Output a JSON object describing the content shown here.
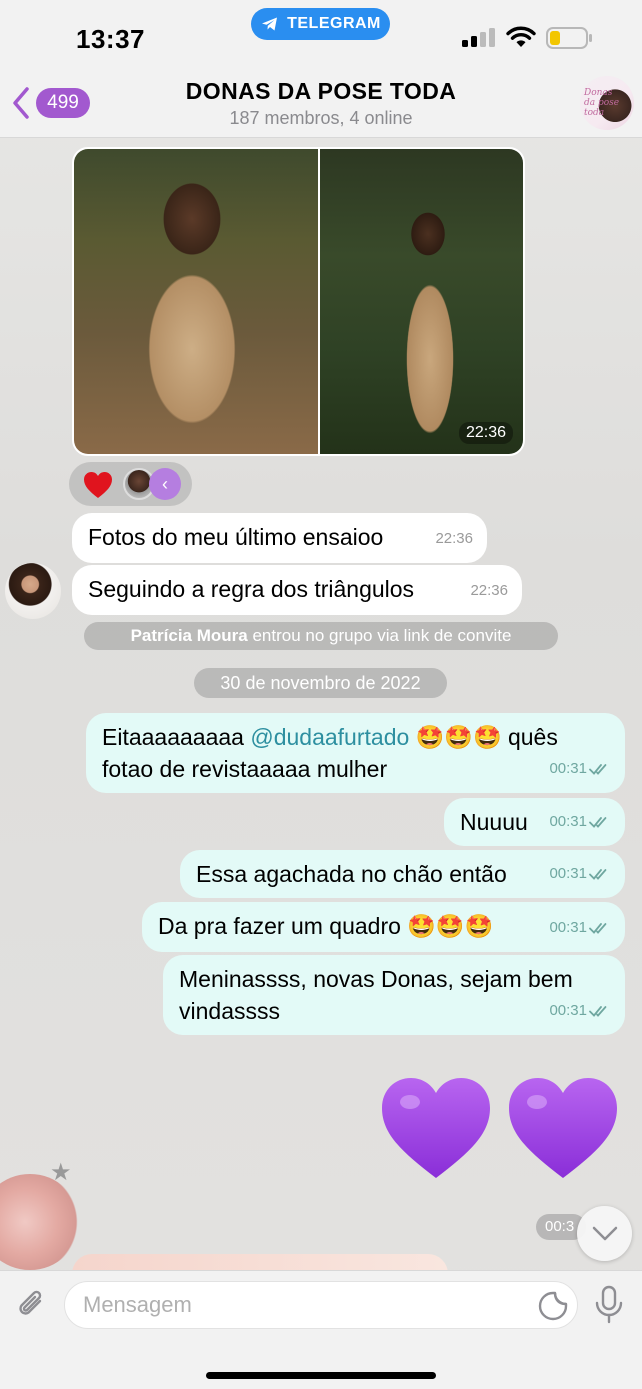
{
  "status_bar": {
    "time": "13:37",
    "app_pill": "TELEGRAM"
  },
  "header": {
    "back_count": "499",
    "title": "DONAS DA POSE TODA",
    "subtitle": "187 membros, 4 online"
  },
  "album": {
    "time": "22:36",
    "reaction_count_icon": "heart-icon"
  },
  "messages": [
    {
      "text": "Fotos do meu último ensaioo",
      "time": "22:36"
    },
    {
      "text": "Seguindo a regra dos triângulos",
      "time": "22:36"
    }
  ],
  "service_join": {
    "name": "Patrícia Moura",
    "text": "entrou no grupo via link de convite"
  },
  "date_divider": "30 de novembro de 2022",
  "outgoing": [
    {
      "prefix": "Eitaaaaaaaaa ",
      "mention": "@dudaafurtado",
      "suffix": " 🤩🤩🤩 quês fotao de revistaaaaa mulher",
      "time": "00:31"
    },
    {
      "text": "Nuuuu",
      "time": "00:31"
    },
    {
      "text": "Essa agachada no chão então",
      "time": "00:31"
    },
    {
      "text": "Da pra fazer um quadro 🤩🤩🤩",
      "time": "00:31"
    },
    {
      "text": "Meninassss, novas Donas, sejam bem vindassss",
      "time": "00:31"
    }
  ],
  "last_time_partial": "00:3",
  "composer": {
    "placeholder": "Mensagem"
  },
  "colors": {
    "accent": "#a259cf",
    "telegram_blue": "#2a8ef0",
    "outgoing_bubble": "#e3faf7",
    "incoming_bubble": "#ffffff",
    "heart_purple": "#9b3ddf"
  }
}
